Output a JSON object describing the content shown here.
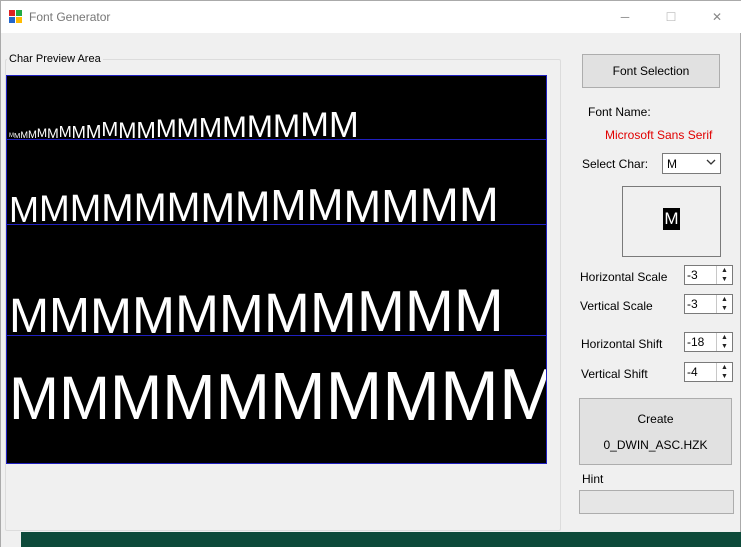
{
  "window": {
    "title": "Font Generator",
    "minimize_glyph": "─",
    "maximize_glyph": "☐",
    "close_glyph": "✕"
  },
  "preview": {
    "group_title": "Char Preview Area",
    "rows": [
      {
        "char": "M",
        "count": 20,
        "size_start": 6,
        "size_end": 36
      },
      {
        "char": "M",
        "count": 14,
        "size_start": 36,
        "size_end": 48
      },
      {
        "char": "M",
        "count": 11,
        "size_start": 48,
        "size_end": 60
      },
      {
        "char": "M",
        "count": 10,
        "size_start": 60,
        "size_end": 72
      }
    ]
  },
  "controls": {
    "font_selection_label": "Font Selection",
    "font_name_label": "Font Name:",
    "font_name_value": "Microsoft Sans Serif",
    "select_char_label": "Select Char:",
    "selected_char": "M",
    "char_preview": "M",
    "horizontal_scale_label": "Horizontal Scale",
    "horizontal_scale_value": "-3",
    "vertical_scale_label": "Vertical Scale",
    "vertical_scale_value": "-3",
    "horizontal_shift_label": "Horizontal Shift",
    "horizontal_shift_value": "-18",
    "vertical_shift_label": "Vertical Shift",
    "vertical_shift_value": "-4",
    "create_label": "Create",
    "create_file": "0_DWIN_ASC.HZK",
    "hint_label": "Hint",
    "hint_value": ""
  },
  "colors": {
    "accent": "#e00000",
    "preview_bg": "#000000",
    "preview_border": "#2020c0"
  },
  "icons": {
    "app": "app-icon",
    "combo_arrow": "chevron-down-icon",
    "spin": "spinner-arrows-icon"
  }
}
